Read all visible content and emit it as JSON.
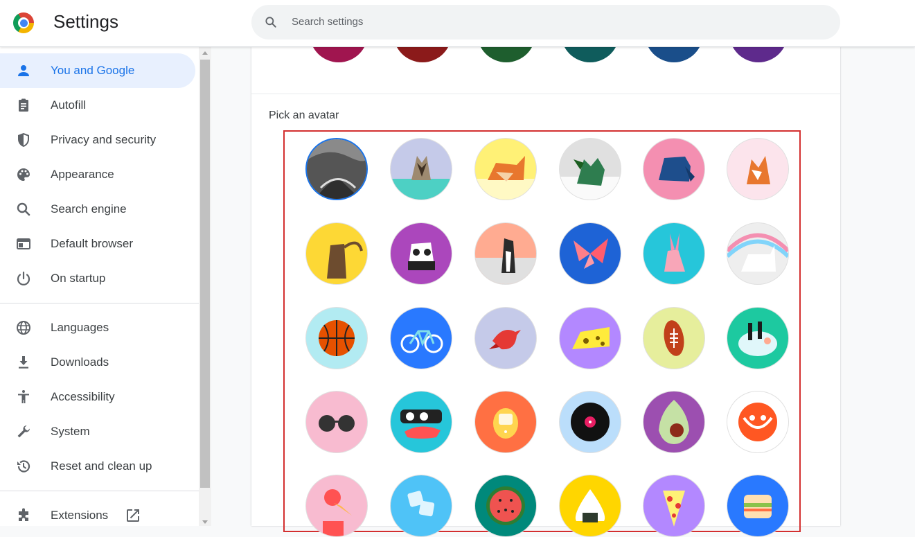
{
  "header": {
    "title": "Settings",
    "search_placeholder": "Search settings"
  },
  "sidebar": {
    "items": [
      {
        "label": "You and Google",
        "icon": "person-icon",
        "active": true
      },
      {
        "label": "Autofill",
        "icon": "clipboard-icon"
      },
      {
        "label": "Privacy and security",
        "icon": "shield-icon"
      },
      {
        "label": "Appearance",
        "icon": "palette-icon"
      },
      {
        "label": "Search engine",
        "icon": "search-icon"
      },
      {
        "label": "Default browser",
        "icon": "browser-window-icon"
      },
      {
        "label": "On startup",
        "icon": "power-icon"
      },
      {
        "label": "Languages",
        "icon": "globe-icon"
      },
      {
        "label": "Downloads",
        "icon": "download-icon"
      },
      {
        "label": "Accessibility",
        "icon": "accessibility-icon"
      },
      {
        "label": "System",
        "icon": "wrench-icon"
      },
      {
        "label": "Reset and clean up",
        "icon": "history-icon"
      },
      {
        "label": "Extensions",
        "icon": "puzzle-icon",
        "external": "open-in-new-icon"
      }
    ]
  },
  "theme_colors": [
    "#a0154f",
    "#8b1a1a",
    "#1e5e2e",
    "#0f5c5c",
    "#1a4e8a",
    "#5e2a8c"
  ],
  "avatar_section": {
    "title": "Pick an avatar",
    "avatars": [
      {
        "name": "landscape-photo-avatar",
        "bg": "#6b6b6b",
        "selected": true
      },
      {
        "name": "origami-cat-avatar",
        "bg": "#c5cae9"
      },
      {
        "name": "origami-fox-avatar",
        "bg": "#fff176"
      },
      {
        "name": "origami-dragon-avatar",
        "bg": "#e0e0e0"
      },
      {
        "name": "origami-elephant-avatar",
        "bg": "#f48fb1"
      },
      {
        "name": "origami-fox-2-avatar",
        "bg": "#fce4ec"
      },
      {
        "name": "origami-monkey-avatar",
        "bg": "#fdd835"
      },
      {
        "name": "origami-panda-avatar",
        "bg": "#ab47bc"
      },
      {
        "name": "origami-penguin-avatar",
        "bg": "#ffab91"
      },
      {
        "name": "origami-butterfly-avatar",
        "bg": "#1e63d6"
      },
      {
        "name": "origami-rabbit-avatar",
        "bg": "#26c6da"
      },
      {
        "name": "origami-unicorn-avatar",
        "bg": "#eeeeee"
      },
      {
        "name": "basketball-avatar",
        "bg": "#b2ebf2"
      },
      {
        "name": "bicycle-avatar",
        "bg": "#2979ff"
      },
      {
        "name": "red-bird-avatar",
        "bg": "#c5cae9"
      },
      {
        "name": "cheese-avatar",
        "bg": "#b388ff"
      },
      {
        "name": "football-avatar",
        "bg": "#e6ee9c"
      },
      {
        "name": "sushi-bowl-avatar",
        "bg": "#1dc9a0"
      },
      {
        "name": "sunglasses-avatar",
        "bg": "#f8bbd0"
      },
      {
        "name": "sushi-rolls-avatar",
        "bg": "#26c6da"
      },
      {
        "name": "tamagotchi-avatar",
        "bg": "#ff7043"
      },
      {
        "name": "vinyl-record-avatar",
        "bg": "#bbdefb"
      },
      {
        "name": "avocado-avatar",
        "bg": "#9c4fb0"
      },
      {
        "name": "smiley-bowl-avatar",
        "bg": "#ffffff"
      },
      {
        "name": "ice-cream-avatar",
        "bg": "#f8bbd0"
      },
      {
        "name": "ice-cubes-avatar",
        "bg": "#4fc3f7"
      },
      {
        "name": "watermelon-avatar",
        "bg": "#00897b"
      },
      {
        "name": "onigiri-avatar",
        "bg": "#ffd600"
      },
      {
        "name": "pizza-avatar",
        "bg": "#b388ff"
      },
      {
        "name": "sandwich-avatar",
        "bg": "#2979ff"
      }
    ]
  },
  "colors": {
    "accent": "#1a73e8",
    "active_nav_bg": "#e8f0fe",
    "highlight_border": "#d32f2f"
  }
}
